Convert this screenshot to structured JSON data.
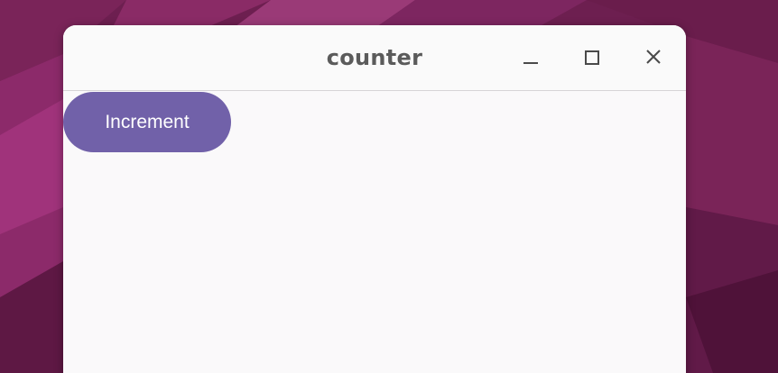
{
  "window": {
    "title": "counter",
    "controls": {
      "minimize_icon": "minimize-icon",
      "maximize_icon": "maximize-icon",
      "close_icon": "close-icon"
    }
  },
  "main": {
    "increment_label": "Increment"
  },
  "colors": {
    "wallpaper": "#6a1f4e",
    "button_bg": "#7161a9",
    "button_text": "#ffffff",
    "window_bg": "#faf9fa",
    "title_text": "#5b5b5b"
  }
}
